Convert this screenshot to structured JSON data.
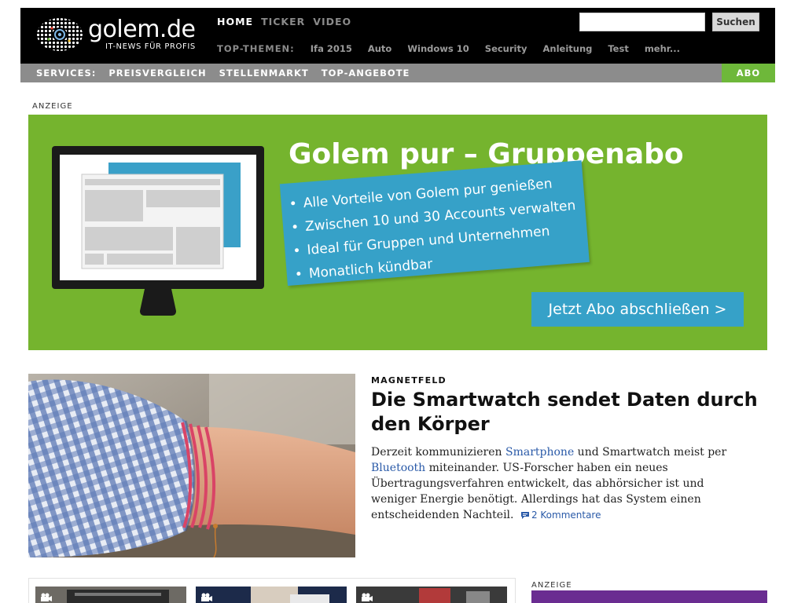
{
  "header": {
    "logo_text": "golem.de",
    "logo_claim": "IT-NEWS FÜR PROFIS",
    "nav": [
      "HOME",
      "TICKER",
      "VIDEO"
    ],
    "top_themes_label": "TOP-THEMEN:",
    "top_themes": [
      "Ifa 2015",
      "Auto",
      "Windows 10",
      "Security",
      "Anleitung",
      "Test",
      "mehr..."
    ],
    "search_value": "",
    "search_button": "Suchen"
  },
  "services": {
    "label": "SERVICES:",
    "items": [
      "PREISVERGLEICH",
      "STELLENMARKT",
      "TOP-ANGEBOTE"
    ],
    "abo": "ABO"
  },
  "ad": {
    "label": "ANZEIGE",
    "title": "Golem pur – Gruppenabo",
    "bullets": [
      "Alle Vorteile von Golem pur genießen",
      "Zwischen 10 und 30 Accounts verwalten",
      "Ideal für Gruppen und Unternehmen",
      "Monatlich kündbar"
    ],
    "cta": "Jetzt Abo abschließen >"
  },
  "article": {
    "kicker": "MAGNETFELD",
    "title": "Die Smartwatch sendet Daten durch den Körper",
    "teaser_1": "Derzeit kommunizieren ",
    "link_1": "Smartphone",
    "teaser_2": " und Smartwatch meist per ",
    "link_2": "Bluetooth",
    "teaser_3": " miteinander. US-Forscher haben ein neues Übertragungsverfahren entwickelt, das abhörsicher ist und weniger Energie benötigt. Allerdings hat das System einen entscheidenden Nachteil.",
    "comments": "2 Kommentare"
  },
  "side_ad_label": "ANZEIGE",
  "colors": {
    "header_bg": "#000000",
    "services_bg": "#8c8c8c",
    "accent_green": "#75b42e",
    "accent_blue": "#36a1c8",
    "link_blue": "#2a5aa8",
    "side_ad_purple": "#6a2c91"
  }
}
